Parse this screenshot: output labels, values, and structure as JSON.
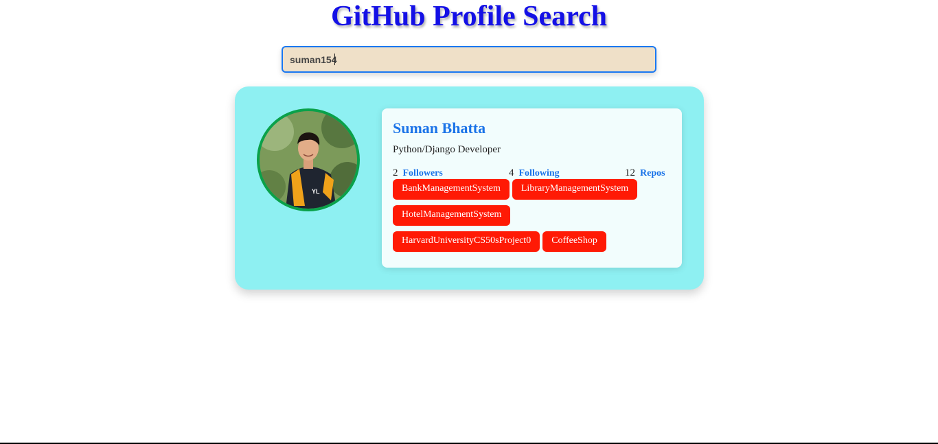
{
  "header": {
    "title": "GitHub Profile Search"
  },
  "search": {
    "value": "suman154"
  },
  "profile": {
    "name": "Suman Bhatta",
    "bio": "Python/Django Developer",
    "followers": {
      "count": "2",
      "label": "Followers"
    },
    "following": {
      "count": "4",
      "label": "Following"
    },
    "repos": {
      "count": "12",
      "label": "Repos"
    },
    "repo_list": [
      "BankManagementSystem",
      "LibraryManagementSystem",
      "HotelManagementSystem",
      "HarvardUniversityCS50sProject0",
      "CoffeeShop"
    ]
  },
  "colors": {
    "title": "#1410e6",
    "card_bg": "#8ef0f2",
    "accent": "#1a73e8",
    "repo_chip": "#ff1a05",
    "avatar_border": "#0aa14a"
  }
}
